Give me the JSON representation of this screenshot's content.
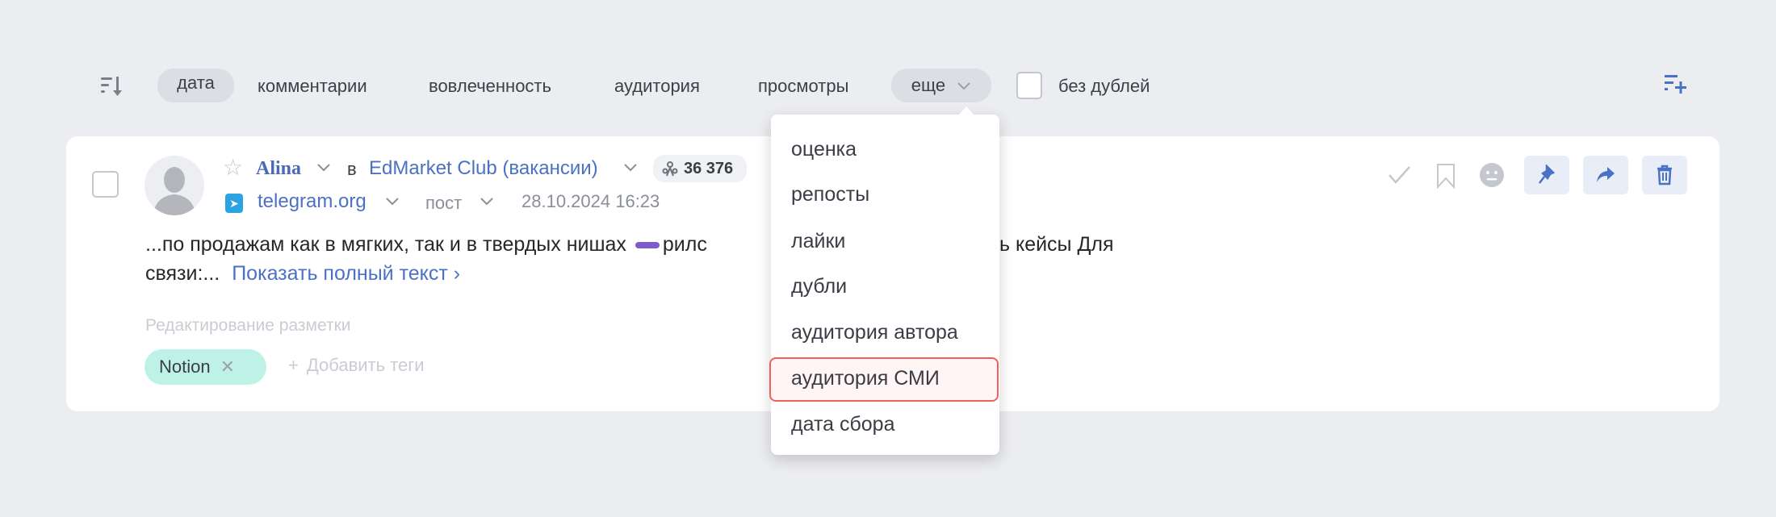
{
  "toolbar": {
    "sort_icon": "sort-descending-icon",
    "sort_options": [
      "дата",
      "комментарии",
      "вовлеченность",
      "аудитория",
      "просмотры"
    ],
    "active_sort": "дата",
    "more_label": "еще",
    "no_duplicates_label": "без дублей",
    "no_duplicates_checked": false,
    "add_icon": "list-add-icon"
  },
  "post": {
    "author": "Alina",
    "in_label": "в",
    "source": "EdMarket Club (вакансии)",
    "audience": "36 376",
    "platform": "telegram.org",
    "type": "пост",
    "datetime": "28.10.2024 16:23",
    "text_line1_start": "...по продажам как в мягких, так и в твердых нишах",
    "text_line1_mid": "рилс",
    "text_line1_end": "ь кейсы Для",
    "text_line2": "связи:...",
    "show_full_text": "Показать полный текст",
    "markup_label": "Редактирование разметки",
    "tags": [
      "Notion"
    ],
    "add_tags_label": "Добавить теги",
    "accent_color": "#4a72c4",
    "tag_color": "#bff2e6"
  },
  "dropdown": {
    "items": [
      "оценка",
      "репосты",
      "лайки",
      "дубли",
      "аудитория автора",
      "аудитория СМИ",
      "дата сбора"
    ],
    "highlighted": "аудитория СМИ",
    "highlight_color": "#f0605c"
  }
}
